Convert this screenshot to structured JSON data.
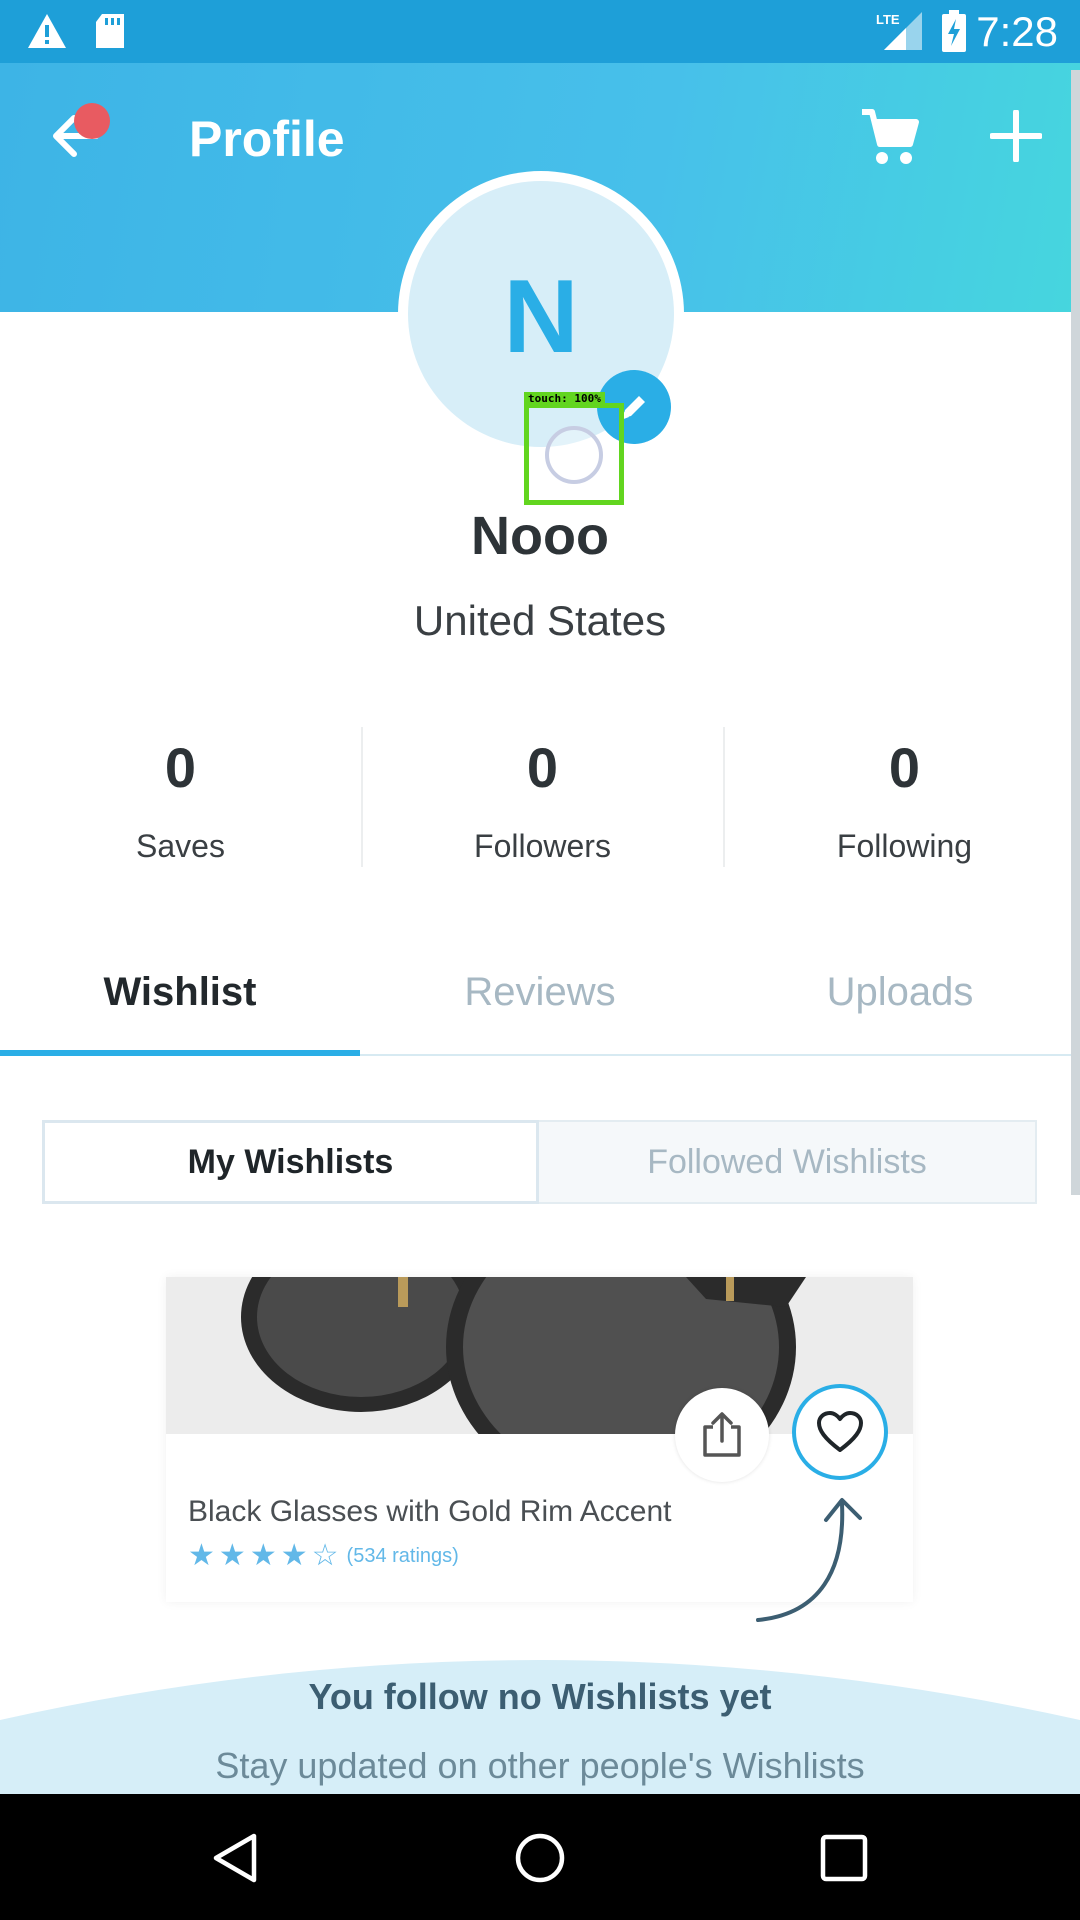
{
  "status_bar": {
    "time": "7:28",
    "network": "LTE",
    "icons": [
      "warning-icon",
      "sd-card-icon",
      "lte-signal-icon",
      "battery-charging-icon"
    ]
  },
  "header": {
    "title": "Profile",
    "back_icon": "arrow-left-icon",
    "cart_icon": "cart-icon",
    "add_icon": "plus-icon",
    "gradient": [
      "#3db4e6",
      "#46d6de"
    ]
  },
  "profile": {
    "initial": "N",
    "name": "Nooo",
    "location": "United States",
    "edit_icon": "pencil-icon"
  },
  "touch_overlay": {
    "label": "touch: 100%"
  },
  "stats": [
    {
      "value": "0",
      "label": "Saves"
    },
    {
      "value": "0",
      "label": "Followers"
    },
    {
      "value": "0",
      "label": "Following"
    }
  ],
  "tabs": [
    {
      "label": "Wishlist",
      "active": true
    },
    {
      "label": "Reviews",
      "active": false
    },
    {
      "label": "Uploads",
      "active": false
    }
  ],
  "segments": {
    "active": "My Wishlists",
    "inactive": "Followed Wishlists"
  },
  "product": {
    "title": "Black Glasses with Gold Rim Accent",
    "rating": 4,
    "rating_max": 5,
    "ratings_text": "(534 ratings)",
    "share_icon": "share-icon",
    "heart_icon": "heart-icon"
  },
  "empty_state": {
    "title": "You follow no Wishlists yet",
    "subtitle": "Stay updated on other people's Wishlists"
  },
  "nav": {
    "back": "nav-back-icon",
    "home": "nav-home-icon",
    "recents": "nav-recents-icon"
  },
  "colors": {
    "accent": "#2aaee6",
    "alert_dot": "#e85b61",
    "touch_box": "#62d51f"
  }
}
